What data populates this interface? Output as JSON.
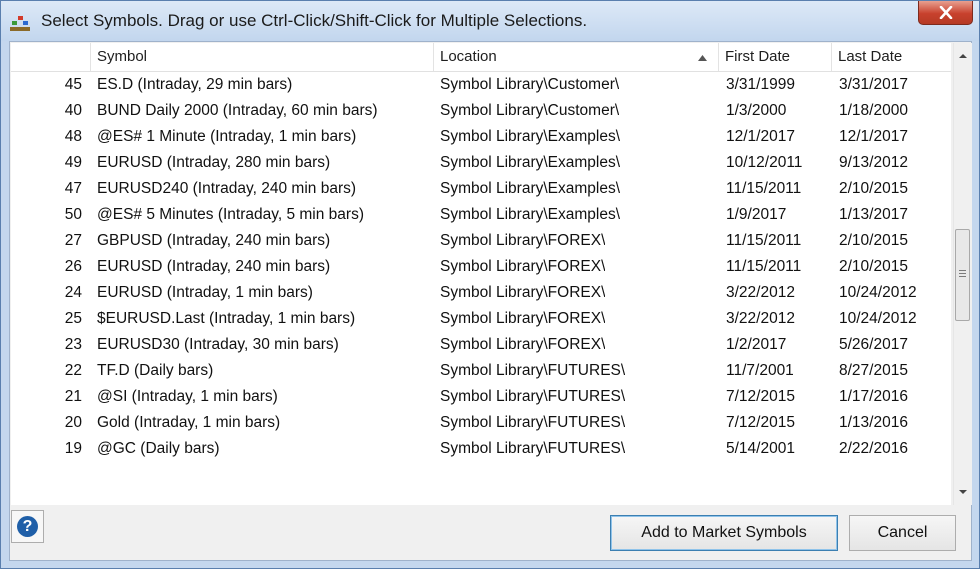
{
  "window": {
    "title": "Select Symbols. Drag or use Ctrl-Click/Shift-Click for Multiple Selections."
  },
  "grid": {
    "columns": {
      "symbol": "Symbol",
      "location": "Location",
      "first_date": "First Date",
      "last_date": "Last Date"
    },
    "rows": [
      {
        "num": "45",
        "symbol": "ES.D (Intraday, 29 min bars)",
        "location": "Symbol Library\\Customer\\",
        "first": "3/31/1999",
        "last": "3/31/2017"
      },
      {
        "num": "40",
        "symbol": "BUND Daily 2000 (Intraday, 60 min bars)",
        "location": "Symbol Library\\Customer\\",
        "first": "1/3/2000",
        "last": "1/18/2000"
      },
      {
        "num": "48",
        "symbol": "@ES# 1 Minute (Intraday, 1 min bars)",
        "location": "Symbol Library\\Examples\\",
        "first": "12/1/2017",
        "last": "12/1/2017"
      },
      {
        "num": "49",
        "symbol": "EURUSD (Intraday, 280 min bars)",
        "location": "Symbol Library\\Examples\\",
        "first": "10/12/2011",
        "last": "9/13/2012"
      },
      {
        "num": "47",
        "symbol": "EURUSD240 (Intraday, 240 min bars)",
        "location": "Symbol Library\\Examples\\",
        "first": "11/15/2011",
        "last": "2/10/2015"
      },
      {
        "num": "50",
        "symbol": "@ES# 5 Minutes (Intraday, 5 min bars)",
        "location": "Symbol Library\\Examples\\",
        "first": "1/9/2017",
        "last": "1/13/2017"
      },
      {
        "num": "27",
        "symbol": "GBPUSD (Intraday, 240 min bars)",
        "location": "Symbol Library\\FOREX\\",
        "first": "11/15/2011",
        "last": "2/10/2015"
      },
      {
        "num": "26",
        "symbol": "EURUSD (Intraday, 240 min bars)",
        "location": "Symbol Library\\FOREX\\",
        "first": "11/15/2011",
        "last": "2/10/2015"
      },
      {
        "num": "24",
        "symbol": "EURUSD (Intraday, 1 min bars)",
        "location": "Symbol Library\\FOREX\\",
        "first": "3/22/2012",
        "last": "10/24/2012"
      },
      {
        "num": "25",
        "symbol": "$EURUSD.Last (Intraday, 1 min bars)",
        "location": "Symbol Library\\FOREX\\",
        "first": "3/22/2012",
        "last": "10/24/2012"
      },
      {
        "num": "23",
        "symbol": "EURUSD30 (Intraday, 30 min bars)",
        "location": "Symbol Library\\FOREX\\",
        "first": "1/2/2017",
        "last": "5/26/2017"
      },
      {
        "num": "22",
        "symbol": "TF.D (Daily bars)",
        "location": "Symbol Library\\FUTURES\\",
        "first": "11/7/2001",
        "last": "8/27/2015"
      },
      {
        "num": "21",
        "symbol": "@SI (Intraday, 1 min bars)",
        "location": "Symbol Library\\FUTURES\\",
        "first": "7/12/2015",
        "last": "1/17/2016"
      },
      {
        "num": "20",
        "symbol": "Gold (Intraday, 1 min bars)",
        "location": "Symbol Library\\FUTURES\\",
        "first": "7/12/2015",
        "last": "1/13/2016"
      },
      {
        "num": "19",
        "symbol": "@GC (Daily bars)",
        "location": "Symbol Library\\FUTURES\\",
        "first": "5/14/2001",
        "last": "2/22/2016"
      }
    ]
  },
  "buttons": {
    "help": "?",
    "add": "Add to Market Symbols",
    "cancel": "Cancel"
  },
  "icons": {
    "app": "symbols-app-icon",
    "close": "close-icon",
    "sort": "sort-ascending-icon",
    "help": "help-icon"
  },
  "colors": {
    "title_bar": "#c2d6ee",
    "close": "#c8412d",
    "help": "#1f5fa8"
  }
}
